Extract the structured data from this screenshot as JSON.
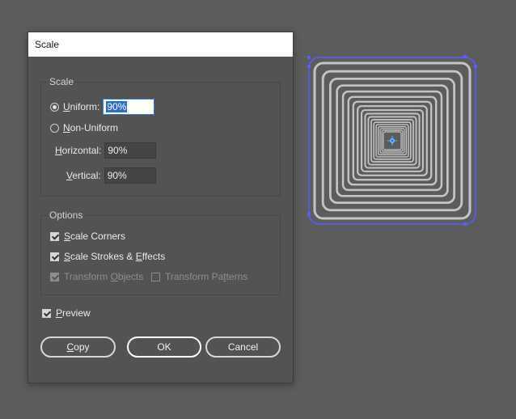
{
  "dialog": {
    "title": "Scale",
    "scale_group": {
      "title": "Scale",
      "uniform": {
        "pre": "",
        "u": "U",
        "post": "niform:",
        "value": "90%",
        "selected": true
      },
      "non_uniform": {
        "pre": "",
        "u": "N",
        "post": "on-Uniform",
        "selected": false
      },
      "horizontal": {
        "pre": "",
        "u": "H",
        "post": "orizontal:",
        "value": "90%"
      },
      "vertical": {
        "pre": "",
        "u": "V",
        "post": "ertical:",
        "value": "90%"
      }
    },
    "options_group": {
      "title": "Options",
      "scale_corners": {
        "pre": "",
        "u": "S",
        "post": "cale Corners",
        "checked": true
      },
      "scale_strokes": {
        "pre": "",
        "u": "S",
        "mid": "cale Strokes & ",
        "u2": "E",
        "post": "ffects",
        "checked": true
      },
      "transform_objects": {
        "pre": "Transform ",
        "u": "O",
        "post": "bjects",
        "checked": true,
        "disabled": true
      },
      "transform_patterns": {
        "pre": "Transform Pa",
        "u": "t",
        "post": "terns",
        "checked": false,
        "disabled": true
      }
    },
    "preview": {
      "u": "P",
      "post": "review",
      "checked": true
    },
    "buttons": {
      "copy": {
        "u": "C",
        "post": "opy"
      },
      "ok": "OK",
      "cancel": "Cancel"
    }
  },
  "artwork": {
    "description_color_selection": "#5b5bff",
    "stroke_color": "#c4c4c4",
    "center_point_color": "#3ab4ff"
  }
}
